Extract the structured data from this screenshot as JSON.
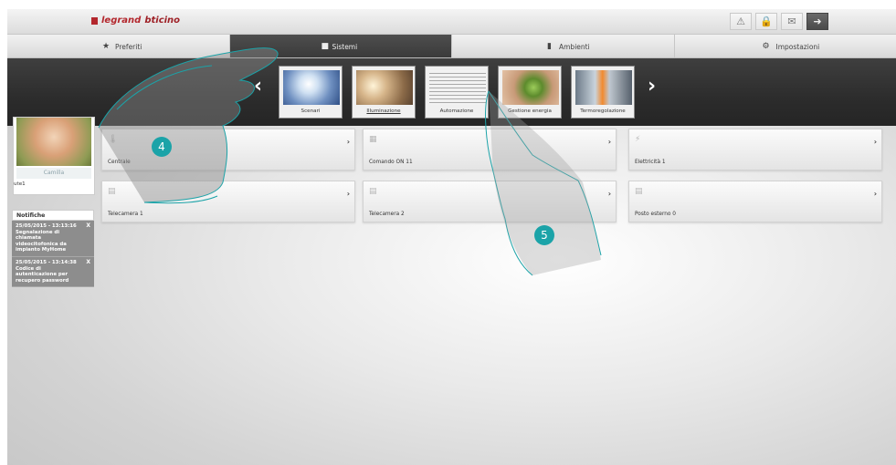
{
  "brand": {
    "legrand": "legrand",
    "bticino": "bticino",
    "accent": "#b3272d"
  },
  "top_icons": [
    {
      "icon": "warning-icon",
      "glyph": "⚠"
    },
    {
      "icon": "lock-icon",
      "glyph": "🔒"
    },
    {
      "icon": "mail-icon",
      "glyph": "✉"
    },
    {
      "icon": "logout-icon",
      "glyph": "➜"
    }
  ],
  "tabs": [
    {
      "label": "Preferiti",
      "icon": "star-icon",
      "glyph": "★"
    },
    {
      "label": "Sistemi",
      "icon": "systems-icon",
      "glyph": "■"
    },
    {
      "label": "Ambienti",
      "icon": "rooms-icon",
      "glyph": "▮"
    },
    {
      "label": "Impostazioni",
      "icon": "settings-icon",
      "glyph": "⚙"
    }
  ],
  "active_tab": "Sistemi",
  "systems": [
    {
      "label": "Scenari"
    },
    {
      "label": "Illuminazione"
    },
    {
      "label": "Automazione"
    },
    {
      "label": "Gestione energia"
    },
    {
      "label": "Termoregolazione"
    }
  ],
  "selected_system": "Illuminazione",
  "nav": {
    "prev": "‹",
    "next": "›"
  },
  "profile": {
    "name": "Camilla",
    "user": "ute1"
  },
  "notifications": {
    "title": "Notifiche",
    "items": [
      {
        "text": "25/05/2015 - 13:13:16 Segnalazione di chiamata videocitofonica da impianto MyHome",
        "close": "X"
      },
      {
        "text": "25/05/2015 - 13:14:38 Codice di autenticazione per recupero password",
        "close": "X"
      }
    ]
  },
  "devices": [
    {
      "label": "Centrale",
      "icon": "thermometer-icon"
    },
    {
      "label": "Comando ON 11",
      "icon": "command-icon"
    },
    {
      "label": "Elettricità 1",
      "icon": "electricity-icon"
    },
    {
      "label": "Telecamera 1",
      "icon": "camera-icon"
    },
    {
      "label": "Telecamera 2",
      "icon": "camera-icon"
    },
    {
      "label": "Posto esterno 0",
      "icon": "camera-icon"
    }
  ],
  "callouts": {
    "one": "4",
    "two": "5"
  },
  "colors": {
    "teal": "#1ba3a8",
    "ribbon": "#2c2c2c"
  }
}
